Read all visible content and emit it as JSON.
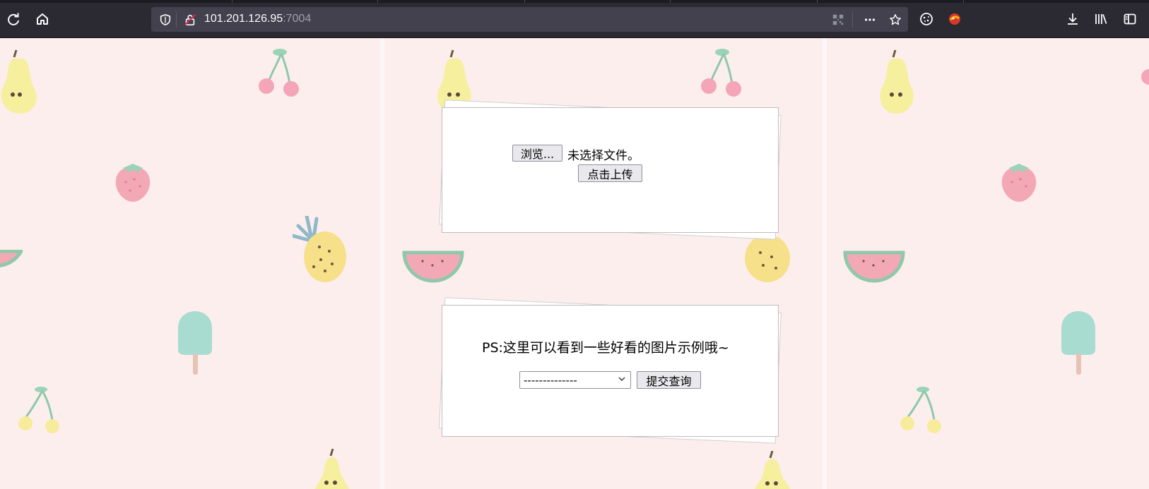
{
  "browser": {
    "url_host": "101.201.126.95",
    "url_port": ":7004",
    "icons": {
      "reload": "reload-icon",
      "home": "home-icon",
      "shield": "tracking-shield-icon",
      "insecure": "insecure-connection-icon",
      "qr": "qr-code-icon",
      "more": "page-actions-icon",
      "bookmark": "bookmark-star-icon",
      "cookie": "cookie-extension-icon",
      "extension": "extension-icon",
      "downloads": "downloads-icon",
      "library": "library-icon",
      "sidebar": "sidebar-icon"
    }
  },
  "upload": {
    "browse_label": "浏览...",
    "no_file_text": "未选择文件。",
    "submit_label": "点击上传"
  },
  "gallery": {
    "hint": "PS:这里可以看到一些好看的图片示例哦~",
    "select_value": "--------------",
    "submit_label": "提交查询"
  },
  "colors": {
    "toolbar": "#2b2a33",
    "urlbar": "#42414d",
    "page_bg": "#fdeeee"
  }
}
